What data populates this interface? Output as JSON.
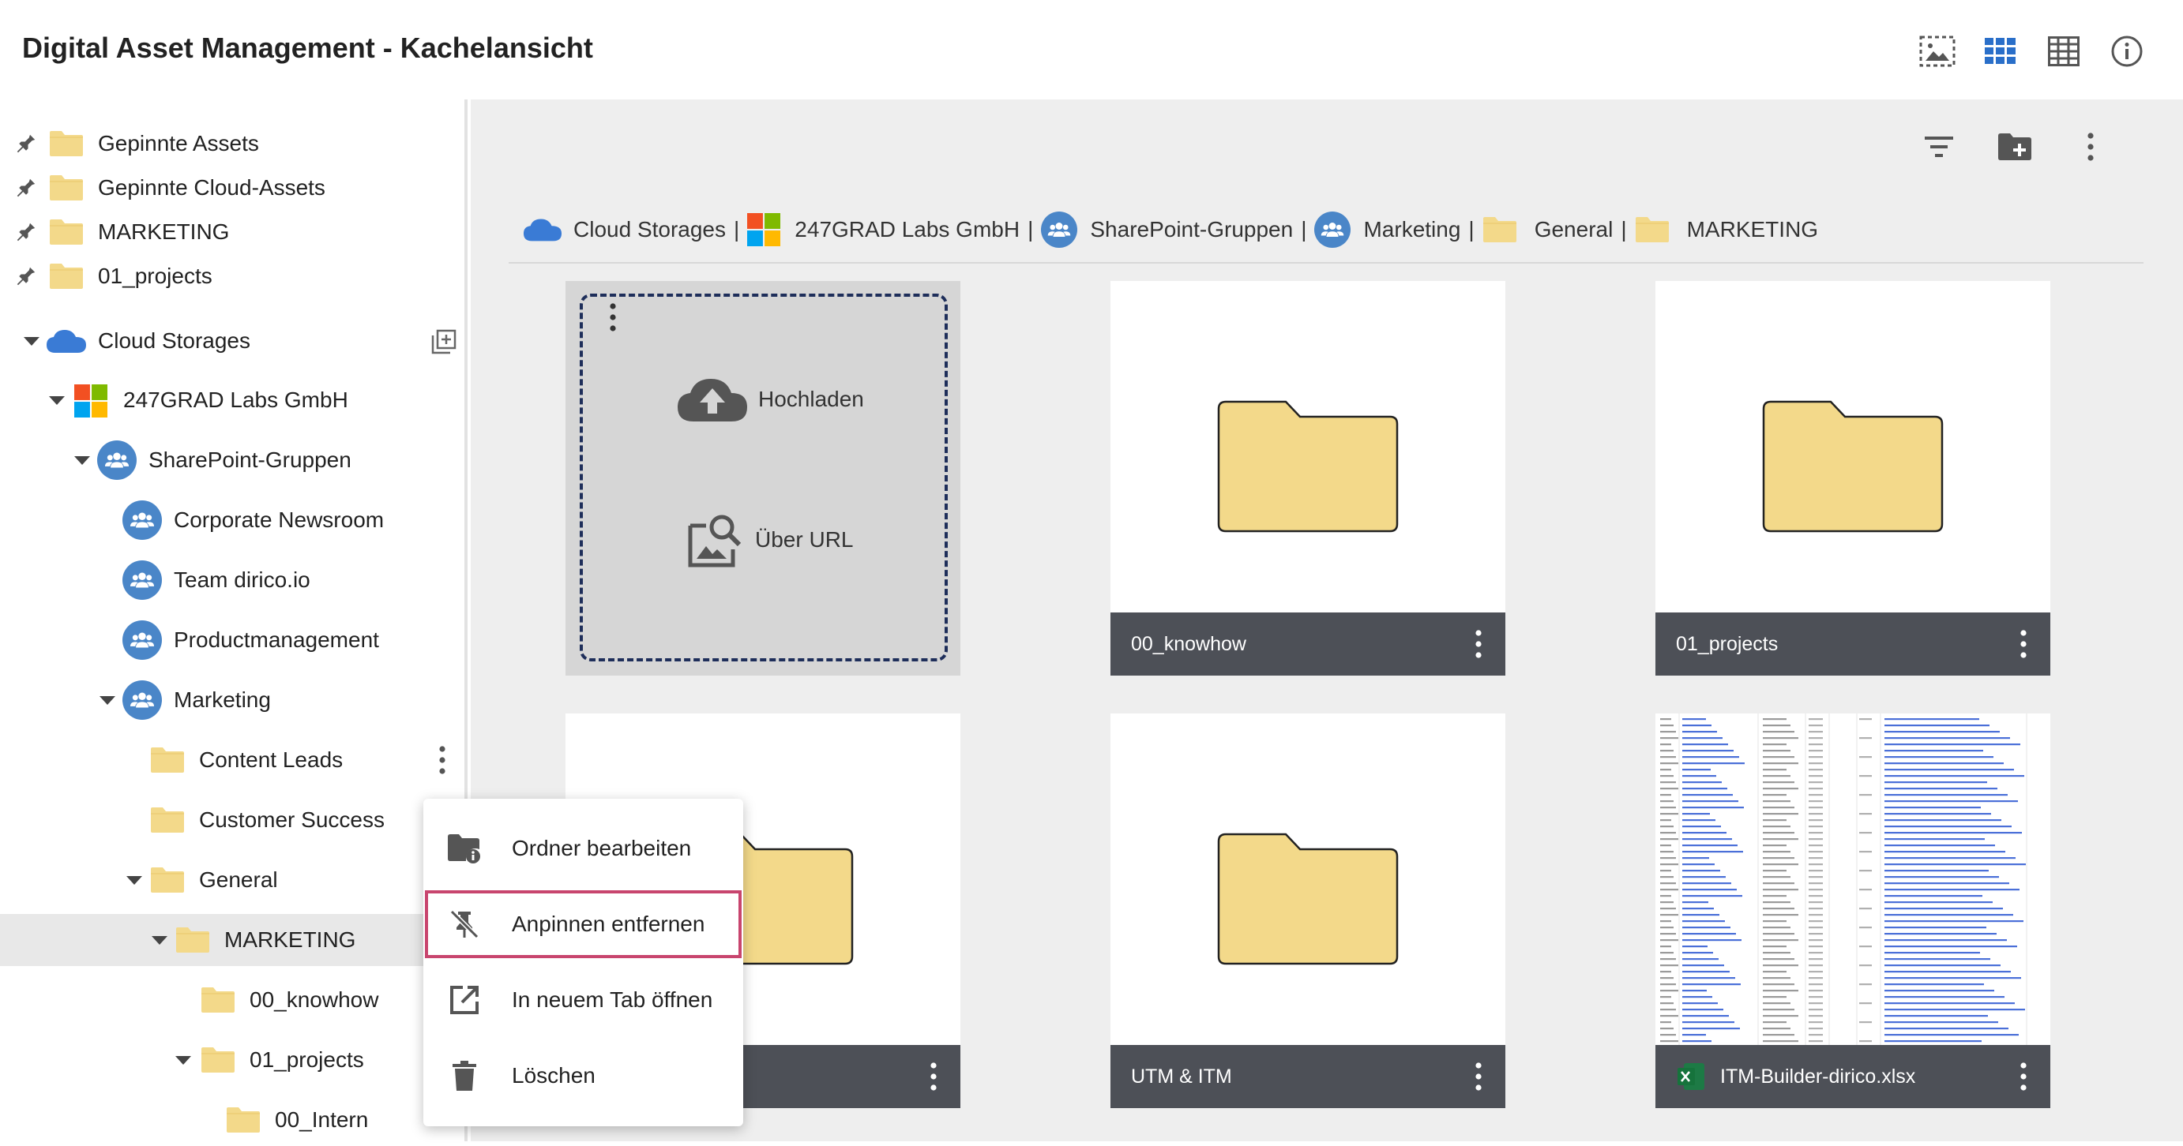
{
  "header": {
    "title": "Digital Asset Management - Kachelansicht",
    "icons": [
      "image-selection-icon",
      "grid-view-icon",
      "table-view-icon",
      "info-icon"
    ]
  },
  "sidebar": {
    "pinned": [
      {
        "label": "Gepinnte Assets"
      },
      {
        "label": "Gepinnte Cloud-Assets"
      },
      {
        "label": "MARKETING"
      },
      {
        "label": "01_projects"
      }
    ],
    "tree": [
      {
        "label": "Cloud Storages"
      },
      {
        "label": "247GRAD Labs GmbH"
      },
      {
        "label": "SharePoint-Gruppen"
      },
      {
        "label": "Corporate Newsroom"
      },
      {
        "label": "Team dirico.io"
      },
      {
        "label": "Productmanagement"
      },
      {
        "label": "Marketing"
      },
      {
        "label": "Content Leads"
      },
      {
        "label": "Customer Success"
      },
      {
        "label": "General"
      },
      {
        "label": "MARKETING"
      },
      {
        "label": "00_knowhow"
      },
      {
        "label": "01_projects"
      },
      {
        "label": "00_Intern"
      }
    ]
  },
  "breadcrumb": [
    {
      "label": "Cloud Storages",
      "icon": "cloud-icon"
    },
    {
      "label": "247GRAD Labs GmbH",
      "icon": "microsoft-logo-icon"
    },
    {
      "label": "SharePoint-Gruppen",
      "icon": "group-icon"
    },
    {
      "label": "Marketing",
      "icon": "group-icon"
    },
    {
      "label": "General",
      "icon": "folder-icon"
    },
    {
      "label": "MARKETING",
      "icon": "folder-icon"
    }
  ],
  "separator": "|",
  "upload": {
    "upload_label": "Hochladen",
    "url_label": "Über URL"
  },
  "tiles": [
    {
      "label": "00_knowhow"
    },
    {
      "label": "01_projects"
    },
    {
      "label": ""
    },
    {
      "label": "UTM & ITM"
    },
    {
      "label": "ITM-Builder-dirico.xlsx"
    }
  ],
  "context_menu": [
    {
      "label": "Ordner bearbeiten",
      "icon": "folder-info-icon"
    },
    {
      "label": "Anpinnen entfernen",
      "icon": "unpin-icon"
    },
    {
      "label": "In neuem Tab öffnen",
      "icon": "open-in-new-icon"
    },
    {
      "label": "Löschen",
      "icon": "trash-icon"
    }
  ],
  "colors": {
    "folder": "#f3d98a",
    "group_blue": "#4a86c8",
    "tile_bar": "#4d5057",
    "highlight": "#c8456e"
  }
}
